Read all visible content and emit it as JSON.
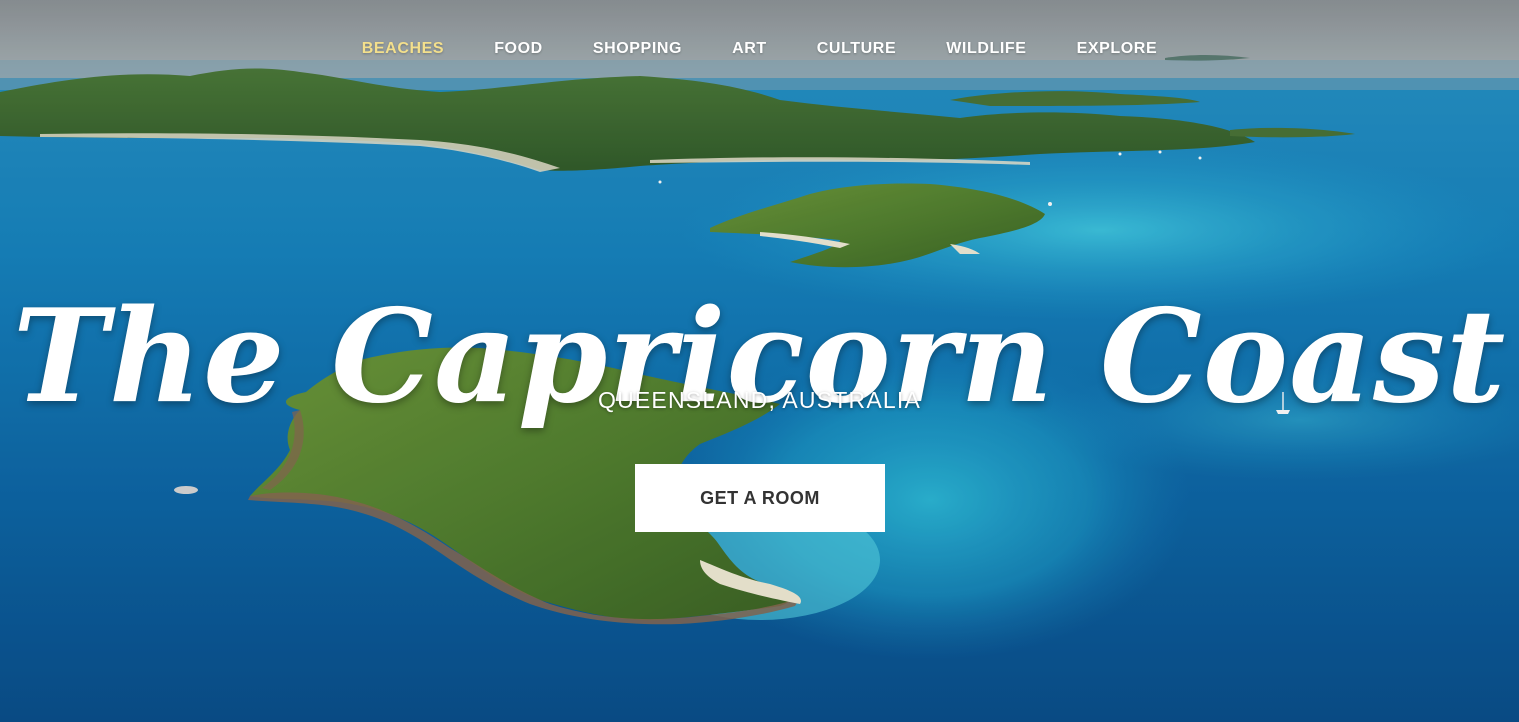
{
  "nav": {
    "items": [
      {
        "label": "BEACHES",
        "active": true
      },
      {
        "label": "FOOD",
        "active": false
      },
      {
        "label": "SHOPPING",
        "active": false
      },
      {
        "label": "ART",
        "active": false
      },
      {
        "label": "CULTURE",
        "active": false
      },
      {
        "label": "WILDLIFE",
        "active": false
      },
      {
        "label": "EXPLORE",
        "active": false
      }
    ],
    "active_color": "#f3df8c"
  },
  "hero": {
    "title": "The Capricorn Coast",
    "subtitle": "QUEENSLAND, AUSTRALIA",
    "cta_label": "GET A ROOM"
  },
  "colors": {
    "ocean_deep": "#0a5a98",
    "ocean_light": "#1fa3d4",
    "shallow": "#3cc6e0",
    "island_green": "#4e7a2c",
    "sky": "#9aa0a4",
    "button_bg": "#ffffff",
    "button_text": "#333333"
  }
}
